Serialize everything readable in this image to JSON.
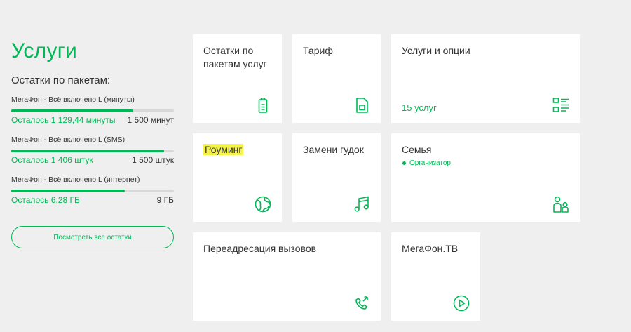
{
  "sidebar": {
    "title": "Услуги",
    "subtitle": "Остатки по пакетам:",
    "packages": [
      {
        "name": "МегаФон - Всё включено L (минуты)",
        "remaining": "Осталось 1 129,44 минуты",
        "total": "1 500 минут",
        "fill": 0.75
      },
      {
        "name": "МегаФон - Всё включено L (SMS)",
        "remaining": "Осталось 1 406 штук",
        "total": "1 500 штук",
        "fill": 0.94
      },
      {
        "name": "МегаФон - Всё включено L (интернет)",
        "remaining": "Осталось 6,28 ГБ",
        "total": "9 ГБ",
        "fill": 0.7
      }
    ],
    "view_all_label": "Посмотреть все остатки"
  },
  "cards": {
    "remains": {
      "title": "Остатки по пакетам услуг",
      "icon": "battery-icon"
    },
    "tariff": {
      "title": "Тариф",
      "icon": "sim-card-icon"
    },
    "services": {
      "title": "Услуги и опции",
      "count": "15 услуг",
      "icon": "options-list-icon"
    },
    "roaming": {
      "title": "Роуминг",
      "icon": "globe-icon"
    },
    "ringtone": {
      "title": "Замени гудок",
      "icon": "music-note-icon"
    },
    "family": {
      "title": "Семья",
      "status": "Организатор",
      "icon": "family-icon"
    },
    "forwarding": {
      "title": "Переадресация вызовов",
      "icon": "call-forward-icon"
    },
    "megafon_tv": {
      "title": "МегаФон.ТВ",
      "icon": "play-icon"
    }
  },
  "colors": {
    "accent": "#00b956",
    "highlight": "#f5f34a",
    "background": "#efefef"
  }
}
